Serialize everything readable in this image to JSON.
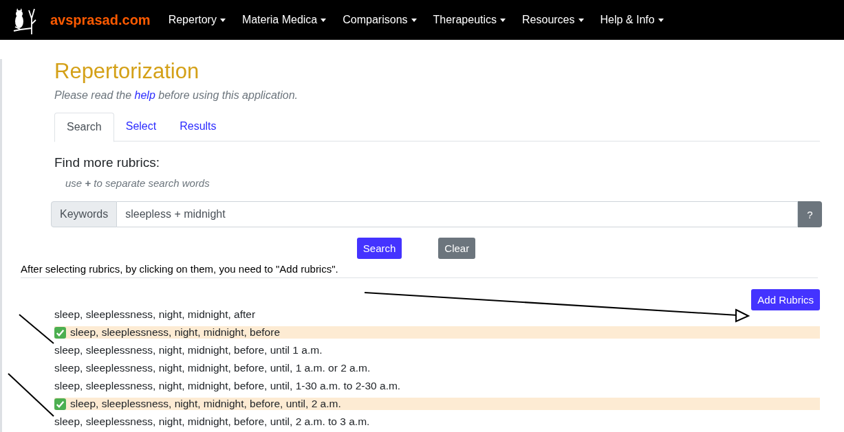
{
  "navbar": {
    "brand": "avsprasad.com",
    "menus": [
      {
        "label": "Repertory"
      },
      {
        "label": "Materia Medica"
      },
      {
        "label": "Comparisons"
      },
      {
        "label": "Therapeutics"
      },
      {
        "label": "Resources"
      },
      {
        "label": "Help & Info"
      }
    ]
  },
  "page": {
    "title": "Repertorization",
    "intro_before": "Please read the",
    "intro_link": "help",
    "intro_after": "before using this application."
  },
  "tabs": [
    {
      "label": "Search",
      "selected": true
    },
    {
      "label": "Select",
      "selected": false
    },
    {
      "label": "Results",
      "selected": false
    }
  ],
  "search": {
    "heading": "Find more rubrics:",
    "hint": "use **+** to separate search words",
    "addon": "Keywords",
    "value": "sleepless + midnight",
    "help_button": "?",
    "search_button": "Search",
    "clear_button": "Clear"
  },
  "instruction": "After selecting rubrics, by clicking on them, you need to \"Add rubrics\".",
  "add_button": "Add Rubrics",
  "rubrics": [
    {
      "text": "sleep, sleeplessness, night, midnight, after",
      "selected": false
    },
    {
      "text": "sleep, sleeplessness, night, midnight, before",
      "selected": true
    },
    {
      "text": "sleep, sleeplessness, night, midnight, before, until 1 a.m.",
      "selected": false
    },
    {
      "text": "sleep, sleeplessness, night, midnight, before, until, 1 a.m. or 2 a.m.",
      "selected": false
    },
    {
      "text": "sleep, sleeplessness, night, midnight, before, until, 1-30 a.m. to 2-30 a.m.",
      "selected": false
    },
    {
      "text": "sleep, sleeplessness, night, midnight, before, until, 2 a.m.",
      "selected": true
    },
    {
      "text": "sleep, sleeplessness, night, midnight, before, until, 2 a.m. to 3 a.m.",
      "selected": false
    }
  ]
}
